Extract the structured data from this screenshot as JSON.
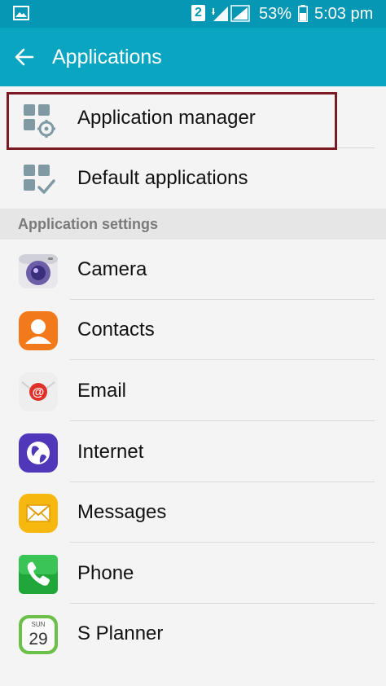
{
  "status_bar": {
    "sim_slot": "2",
    "battery": "53%",
    "time": "5:03 pm"
  },
  "app_bar": {
    "title": "Applications"
  },
  "top_items": [
    {
      "label": "Application manager",
      "icon": "app-manager-icon"
    },
    {
      "label": "Default applications",
      "icon": "default-apps-icon"
    }
  ],
  "section": {
    "title": "Application settings"
  },
  "apps": [
    {
      "label": "Camera",
      "icon": "camera-icon"
    },
    {
      "label": "Contacts",
      "icon": "contacts-icon"
    },
    {
      "label": "Email",
      "icon": "email-icon"
    },
    {
      "label": "Internet",
      "icon": "internet-icon"
    },
    {
      "label": "Messages",
      "icon": "messages-icon"
    },
    {
      "label": "Phone",
      "icon": "phone-icon"
    },
    {
      "label": "S Planner",
      "icon": "calendar-icon",
      "icon_text": "SUN",
      "icon_day": "29"
    }
  ],
  "colors": {
    "status_bar": "#0597b3",
    "app_bar": "#0aa6c1",
    "highlight_border": "#7a1a24"
  }
}
